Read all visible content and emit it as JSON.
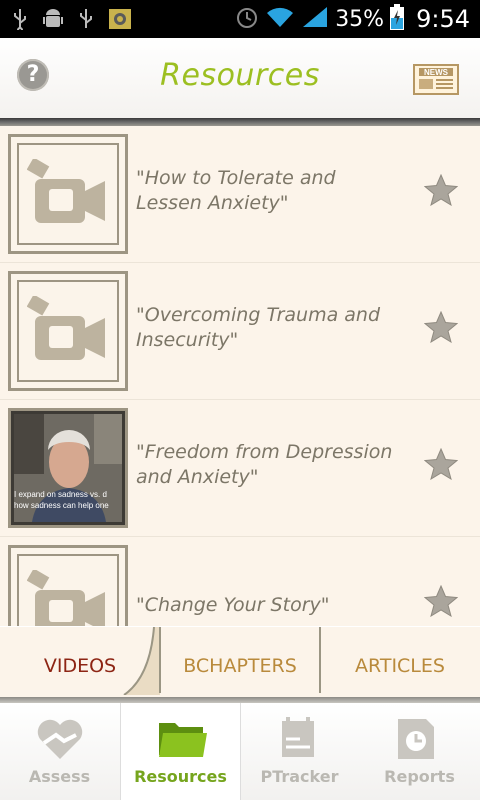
{
  "status_bar": {
    "battery_percent": "35%",
    "time": "9:54",
    "icons": [
      "usb-icon",
      "android-debug-icon",
      "usb-icon",
      "app-notification-icon",
      "alarm-icon",
      "wifi-icon",
      "signal-icon",
      "battery-charging-icon"
    ]
  },
  "header": {
    "title": "Resources",
    "help_icon": "help-icon",
    "news_icon": "news-icon"
  },
  "videos": [
    {
      "title": "\"How to Tolerate and Lessen Anxiety\"",
      "thumbnail": "video-camera-icon",
      "starred": false
    },
    {
      "title": "\"Overcoming Trauma and Insecurity\"",
      "thumbnail": "video-camera-icon",
      "starred": false
    },
    {
      "title": "\"Freedom from Depression and Anxiety\"",
      "thumbnail": "video-photo",
      "thumbnail_caption": "I expand on sadness vs. d\nhow sadness can help one",
      "starred": false
    },
    {
      "title": "\"Change Your Story\"",
      "thumbnail": "video-camera-icon",
      "starred": false
    }
  ],
  "tabs": {
    "videos": "VIDEOS",
    "bchapters": "BCHAPTERS",
    "articles": "ARTICLES",
    "active": "videos"
  },
  "bottom_nav": {
    "assess": "Assess",
    "resources": "Resources",
    "ptracker": "PTracker",
    "reports": "Reports",
    "active": "resources"
  },
  "colors": {
    "title_green": "#9cbf21",
    "active_tab": "#8d2514",
    "inactive_tab": "#b98a3c",
    "list_bg": "#fcf4ea"
  }
}
